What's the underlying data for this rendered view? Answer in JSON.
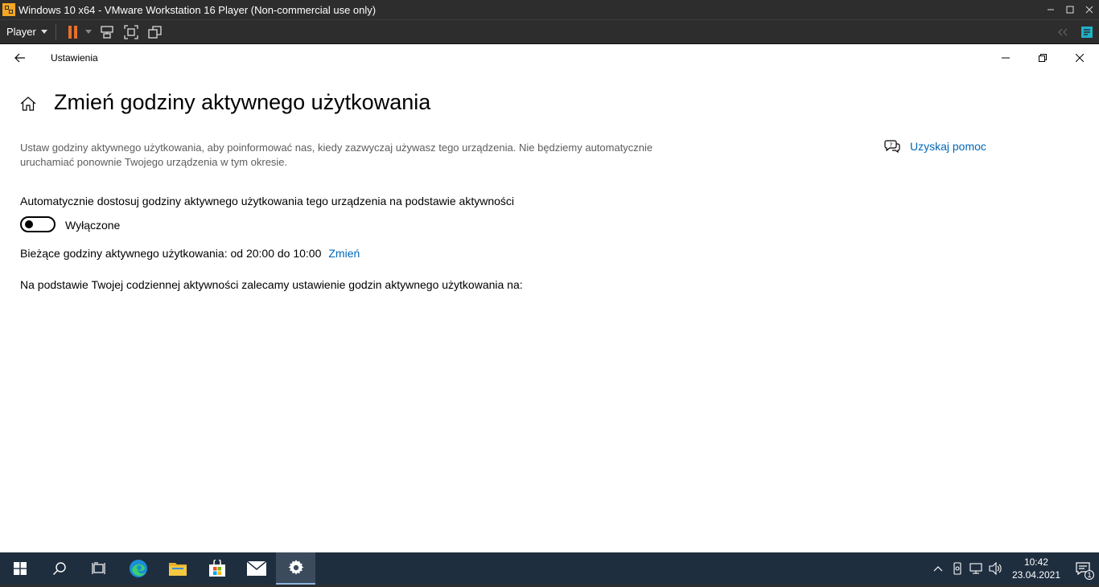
{
  "vm": {
    "title": "Windows 10 x64 - VMware Workstation 16 Player (Non-commercial use only)",
    "player_label": "Player"
  },
  "settings": {
    "app_title": "Ustawienia",
    "page_title": "Zmień godziny aktywnego użytkowania",
    "description": "Ustaw godziny aktywnego użytkowania, aby poinformować nas, kiedy zazwyczaj używasz tego urządzenia. Nie będziemy automatycznie uruchamiać ponownie Twojego urządzenia w tym okresie.",
    "help_link": "Uzyskaj pomoc",
    "auto_adjust_label": "Automatycznie dostosuj godziny aktywnego użytkowania tego urządzenia na podstawie aktywności",
    "toggle_state": "Wyłączone",
    "current_hours_text": "Bieżące godziny aktywnego użytkowania: od 20:00 do 10:00",
    "change_link": "Zmień",
    "recommendation_text": "Na podstawie Twojej codziennej aktywności zalecamy ustawienie godzin aktywnego użytkowania na:"
  },
  "taskbar": {
    "time": "10:42",
    "date": "23.04.2021",
    "notification_count": "1"
  }
}
